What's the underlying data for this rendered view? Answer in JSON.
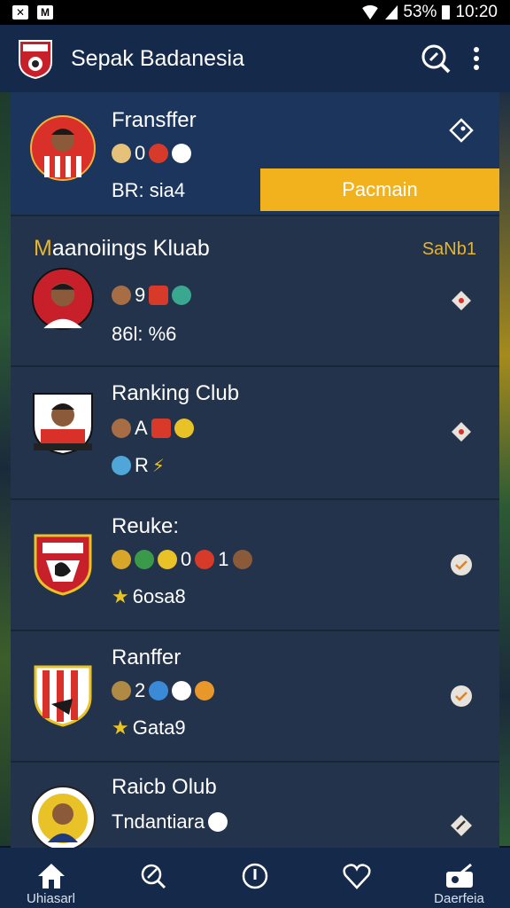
{
  "status_bar": {
    "battery": "53%",
    "time": "10:20"
  },
  "app": {
    "title": "Sepak Badanesia"
  },
  "cards": [
    {
      "title": "Fransffer",
      "stat_line": "0",
      "meta": "BR: sia4",
      "button": "Pacmain"
    },
    {
      "section_prefix": "M",
      "section_title": "aanoiings Kluab",
      "badge": "SaNb1",
      "stat_line": "9",
      "meta": "86l: %6"
    },
    {
      "title": "Ranking Club",
      "stat_line": "A",
      "meta": "R"
    },
    {
      "title": "Reuke:",
      "stat_line": "0",
      "stat_line_b": "1",
      "meta": "6osa8"
    },
    {
      "title": "Ranffer",
      "stat_line": "2",
      "meta": "Gata9"
    },
    {
      "title": "Raicb Olub",
      "meta": "Tndantiara"
    }
  ],
  "nav": {
    "home": "Uhiasarl",
    "profile": "Daerfeia"
  },
  "colors": {
    "app_bar": "#15294a",
    "card": "#22334b",
    "accent": "#f2b21e"
  }
}
